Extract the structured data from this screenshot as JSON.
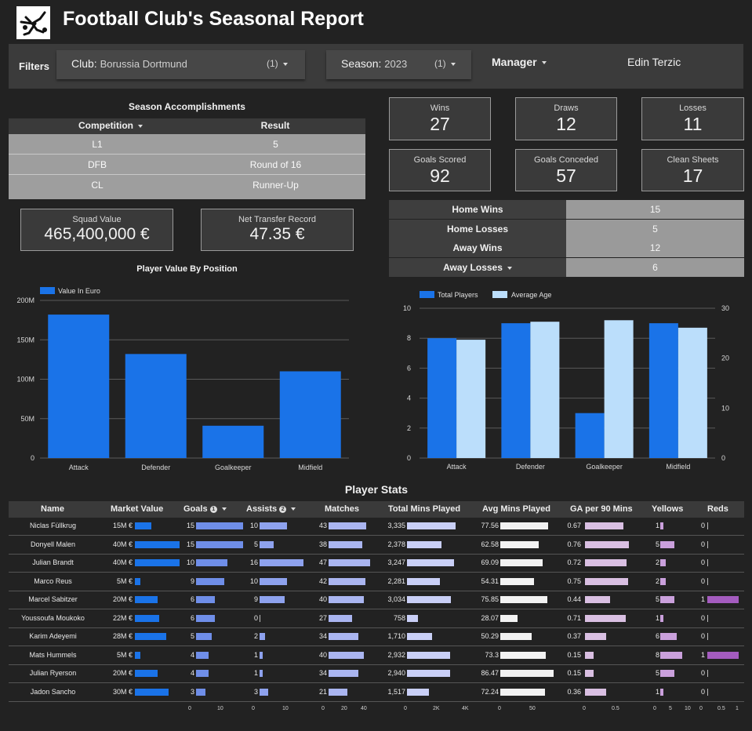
{
  "header": {
    "title": "Football Club's Seasonal Report",
    "logo_icon": "bicycle-kick-player-icon"
  },
  "filters": {
    "label": "Filters",
    "club": {
      "label": "Club",
      "value": "Borussia Dortmund",
      "count": "(1)"
    },
    "season": {
      "label": "Season",
      "value": "2023",
      "count": "(1)"
    },
    "manager": {
      "label": "Manager",
      "value": "Edin Terzic"
    }
  },
  "accomplishments": {
    "title": "Season Accomplishments",
    "headers": [
      "Competition",
      "Result"
    ],
    "rows": [
      [
        "L1",
        "5"
      ],
      [
        "DFB",
        "Round of 16"
      ],
      [
        "CL",
        "Runner-Up"
      ]
    ]
  },
  "squad": {
    "value_label": "Squad Value",
    "value": "465,400,000 €",
    "transfer_label": "Net Transfer Record",
    "transfer": "47.35 €"
  },
  "kpis": [
    {
      "label": "Wins",
      "value": "27"
    },
    {
      "label": "Draws",
      "value": "12"
    },
    {
      "label": "Losses",
      "value": "11"
    },
    {
      "label": "Goals Scored",
      "value": "92"
    },
    {
      "label": "Goals Conceded",
      "value": "57"
    },
    {
      "label": "Clean Sheets",
      "value": "17"
    }
  ],
  "homeaway": [
    {
      "label": "Home Wins",
      "value": "15"
    },
    {
      "label": "Home Losses",
      "value": "5"
    },
    {
      "label": "Away Wins",
      "value": "12"
    },
    {
      "label": "Away Losses",
      "value": "6"
    }
  ],
  "chart_data": [
    {
      "type": "bar",
      "title": "Player Value By Position",
      "categories": [
        "Attack",
        "Defender",
        "Goalkeeper",
        "Midfield"
      ],
      "series": [
        {
          "name": "Value In Euro",
          "values": [
            182000000,
            132000000,
            41000000,
            110000000
          ],
          "color": "#1a73e8"
        }
      ],
      "ylim": [
        0,
        200000000
      ],
      "yticks": [
        "0",
        "50M",
        "100M",
        "150M",
        "200M"
      ],
      "legend": "top-left",
      "grid": true
    },
    {
      "type": "bar",
      "categories": [
        "Attack",
        "Defender",
        "Goalkeeper",
        "Midfield"
      ],
      "series": [
        {
          "name": "Total Players",
          "values": [
            8,
            9,
            3,
            9
          ],
          "axis": "left",
          "color": "#1a73e8"
        },
        {
          "name": "Average Age",
          "values": [
            23.7,
            27.3,
            27.6,
            26.1
          ],
          "axis": "right",
          "color": "#bbdefb"
        }
      ],
      "ylim": [
        0,
        10
      ],
      "ylim_right": [
        0,
        30
      ],
      "yticks": [
        "0",
        "2",
        "4",
        "6",
        "8",
        "10"
      ],
      "yticks_right": [
        "0",
        "10",
        "20",
        "30"
      ],
      "legend": "top-left",
      "grid": true
    },
    {
      "type": "table",
      "title": "Player Stats",
      "columns": [
        "Name",
        "Market Value",
        "Goals",
        "Assists",
        "Matches",
        "Total Mins Played",
        "Avg Mins Played",
        "GA per 90 Mins",
        "Yellows",
        "Reds"
      ],
      "rows": [
        [
          "Niclas Füllkrug",
          "15M €",
          "15",
          "10",
          "43",
          "3,335",
          "77.56",
          "0.67",
          "1",
          "0"
        ],
        [
          "Donyell Malen",
          "40M €",
          "15",
          "5",
          "38",
          "2,378",
          "62.58",
          "0.76",
          "5",
          "0"
        ],
        [
          "Julian Brandt",
          "40M €",
          "10",
          "16",
          "47",
          "3,247",
          "69.09",
          "0.72",
          "2",
          "0"
        ],
        [
          "Marco Reus",
          "5M €",
          "9",
          "10",
          "42",
          "2,281",
          "54.31",
          "0.75",
          "2",
          "0"
        ],
        [
          "Marcel Sabitzer",
          "20M €",
          "6",
          "9",
          "40",
          "3,034",
          "75.85",
          "0.44",
          "5",
          "1"
        ],
        [
          "Youssoufa Moukoko",
          "22M €",
          "6",
          "0",
          "27",
          "758",
          "28.07",
          "0.71",
          "1",
          "0"
        ],
        [
          "Karim Adeyemi",
          "28M €",
          "5",
          "2",
          "34",
          "1,710",
          "50.29",
          "0.37",
          "6",
          "0"
        ],
        [
          "Mats Hummels",
          "5M €",
          "4",
          "1",
          "40",
          "2,932",
          "73.3",
          "0.15",
          "8",
          "1"
        ],
        [
          "Julian Ryerson",
          "20M €",
          "4",
          "1",
          "34",
          "2,940",
          "86.47",
          "0.15",
          "5",
          "0"
        ],
        [
          "Jadon Sancho",
          "30M €",
          "3",
          "3",
          "21",
          "1,517",
          "72.24",
          "0.36",
          "1",
          "0"
        ]
      ],
      "axis_ticks": {
        "goals": [
          "0",
          "10"
        ],
        "assists": [
          "0",
          "10"
        ],
        "matches": [
          "0",
          "20",
          "40"
        ],
        "total_mins": [
          "0",
          "2K",
          "4K"
        ],
        "avg_mins": [
          "0",
          "50"
        ],
        "ga": [
          "0",
          "0.5"
        ],
        "yellows": [
          "0",
          "5",
          "10"
        ],
        "reds": [
          "0",
          "0.5",
          "1"
        ]
      },
      "bar_colors": {
        "market": "#1a73e8",
        "goals": "#6f8ee8",
        "assists": "#8ea2ee",
        "matches": "#aab5f0",
        "total_mins": "#c9cff6",
        "avg_mins": "#f2f2f2",
        "ga": "#d9bfe2",
        "yellows": "#caa0dc",
        "reds": "#a45cbf"
      }
    }
  ]
}
